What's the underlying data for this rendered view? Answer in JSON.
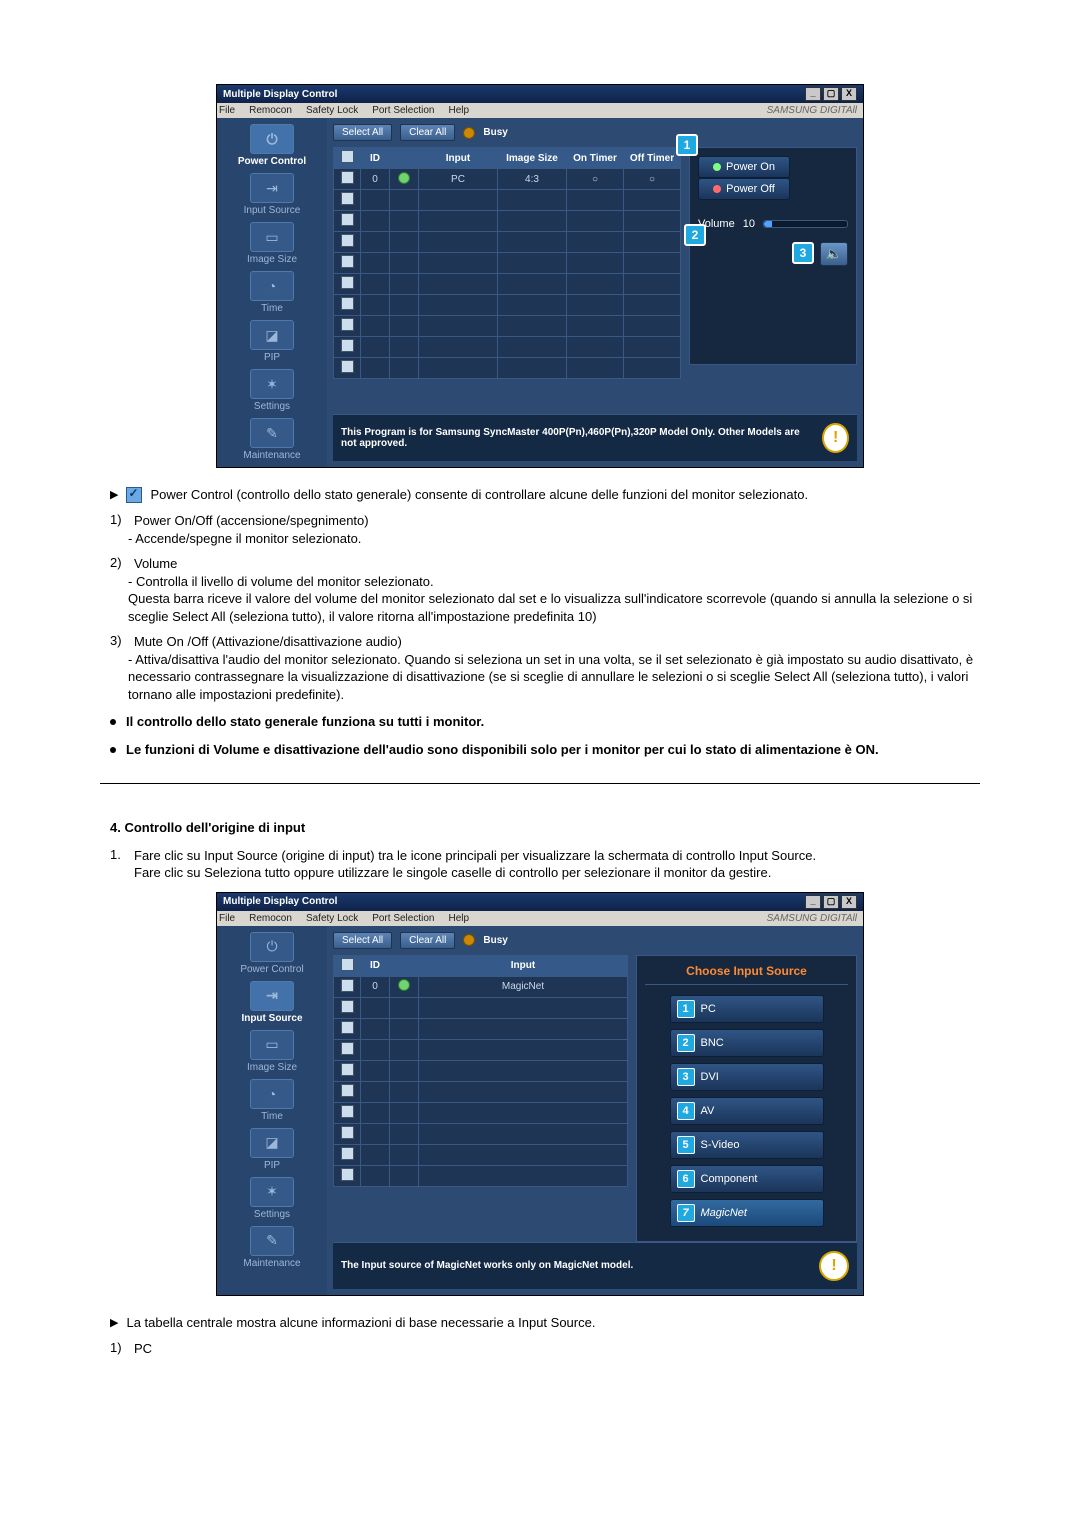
{
  "window": {
    "title": "Multiple Display Control",
    "menu": [
      "File",
      "Remocon",
      "Safety Lock",
      "Port Selection",
      "Help"
    ],
    "brand": "SAMSUNG DIGITAll"
  },
  "toolbar": {
    "select_all": "Select All",
    "clear_all": "Clear All",
    "busy": "Busy"
  },
  "sidebar": {
    "power_control": "Power Control",
    "input_source": "Input Source",
    "image_size": "Image Size",
    "time": "Time",
    "pip": "PIP",
    "settings": "Settings",
    "maintenance": "Maintenance"
  },
  "power_screen": {
    "headers": {
      "chk": "",
      "id": "ID",
      "st": "",
      "input": "Input",
      "size": "Image Size",
      "on": "On Timer",
      "off": "Off Timer"
    },
    "row0": {
      "id": "0",
      "input": "PC",
      "size": "4:3",
      "on": "○",
      "off": "○"
    },
    "power_on": "Power On",
    "power_off": "Power Off",
    "volume_label": "Volume",
    "volume_value": "10",
    "callout1": "1",
    "callout2": "2",
    "callout3": "3",
    "footer": "This Program is for Samsung SyncMaster 400P(Pn),460P(Pn),320P  Model Only. Other Models are not approved."
  },
  "doc": {
    "pc_intro": "Power Control (controllo dello stato generale) consente di controllare alcune delle funzioni del monitor selezionato.",
    "i1_title": "Power On/Off (accensione/spegnimento)",
    "i1_sub": "- Accende/spegne il monitor selezionato.",
    "i2_title": "Volume",
    "i2_sub1": "- Controlla il livello di volume del monitor selezionato.",
    "i2_sub2": "Questa barra riceve il valore del volume del monitor selezionato dal set e lo visualizza sull'indicatore scorrevole (quando si annulla la selezione o si sceglie Select All (seleziona tutto), il valore ritorna all'impostazione predefinita 10)",
    "i3_title": "Mute On /Off (Attivazione/disattivazione audio)",
    "i3_sub": "- Attiva/disattiva l'audio del monitor selezionato. Quando si seleziona un set in una volta, se il set selezionato è già impostato su audio disattivato, è necessario contrassegnare la visualizzazione di disattivazione (se si sceglie di annullare le selezioni o si sceglie Select All (seleziona tutto), i valori tornano alle impostazioni predefinite).",
    "b1": "Il controllo dello stato generale funziona su tutti i monitor.",
    "b2": "Le funzioni di Volume e disattivazione dell'audio sono disponibili solo per i monitor per cui lo stato di alimentazione è ON."
  },
  "section2": {
    "title": "4. Controllo dell'origine di input",
    "p1a": "Fare clic su Input Source (origine di input) tra le icone principali per visualizzare la schermata di controllo Input Source.",
    "p1b": "Fare clic su Seleziona tutto oppure utilizzare le singole caselle di controllo per selezionare il monitor da gestire."
  },
  "input_screen": {
    "headers": {
      "id": "ID",
      "input": "Input"
    },
    "row0": {
      "id": "0",
      "input": "MagicNet"
    },
    "panel_title": "Choose Input Source",
    "buttons": {
      "pc": {
        "n": "1",
        "label": "PC"
      },
      "bnc": {
        "n": "2",
        "label": "BNC"
      },
      "dvi": {
        "n": "3",
        "label": "DVI"
      },
      "av": {
        "n": "4",
        "label": "AV"
      },
      "svideo": {
        "n": "5",
        "label": "S-Video"
      },
      "component": {
        "n": "6",
        "label": "Component"
      },
      "magicnet": {
        "n": "7",
        "label": "MagicNet"
      }
    },
    "footer": "The Input source of MagicNet works only on MagicNet model."
  },
  "doc2": {
    "arrow1": "La tabella centrale mostra alcune informazioni di base necessarie a Input Source.",
    "i1": "PC"
  }
}
